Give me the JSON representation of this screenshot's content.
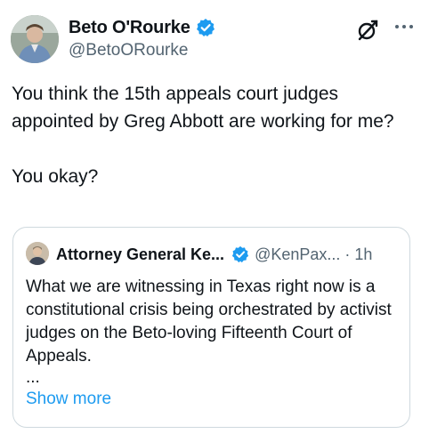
{
  "author": {
    "display_name": "Beto O'Rourke",
    "handle": "@BetoORourke",
    "verified": true,
    "accent_color": "#1d9bf0"
  },
  "tweet": {
    "text": "You think the 15th appeals court judges appointed by Greg Abbott are working for me?\n\nYou okay?"
  },
  "actions": {
    "grok_icon": "grok-icon",
    "more_icon": "more-icon"
  },
  "quoted_tweet": {
    "display_name": "Attorney General Ke...",
    "handle": "@KenPax...",
    "separator": "·",
    "time": "1h",
    "verified": true,
    "text": "What we are witnessing in Texas right now is a constitutional crisis being orchestrated by activist judges on the Beto-loving Fifteenth Court of Appeals.",
    "ellipsis": "...",
    "show_more_label": "Show more"
  }
}
